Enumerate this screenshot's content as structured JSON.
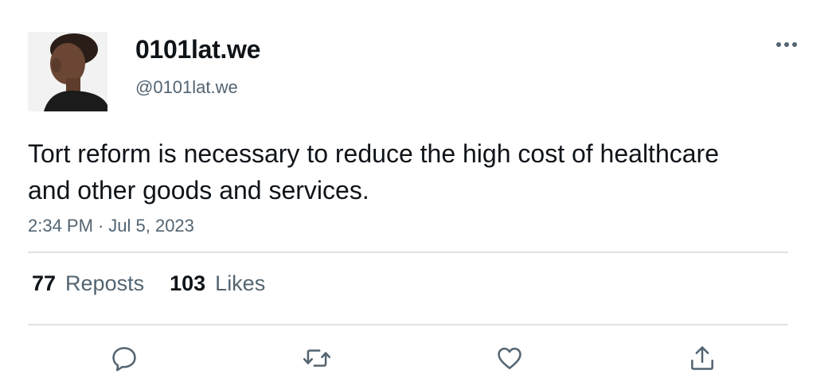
{
  "author": {
    "display_name": "0101lat.we",
    "handle": "@0101lat.we",
    "avatar_icon": "profile-photo"
  },
  "tweet": {
    "text": "Tort reform is necessary to reduce the high cost of healthcare and other goods and services.",
    "time": "2:34 PM",
    "separator": "·",
    "date": "Jul 5, 2023"
  },
  "stats": {
    "reposts_count": "77",
    "reposts_label": "Reposts",
    "likes_count": "103",
    "likes_label": "Likes"
  },
  "actions": {
    "reply_icon": "reply-icon",
    "repost_icon": "repost-icon",
    "like_icon": "like-icon",
    "share_icon": "share-icon",
    "more_icon": "more-icon"
  },
  "colors": {
    "text_primary": "#0f1419",
    "text_secondary": "#536471",
    "divider": "#dfe3e6",
    "icon": "#536471"
  }
}
